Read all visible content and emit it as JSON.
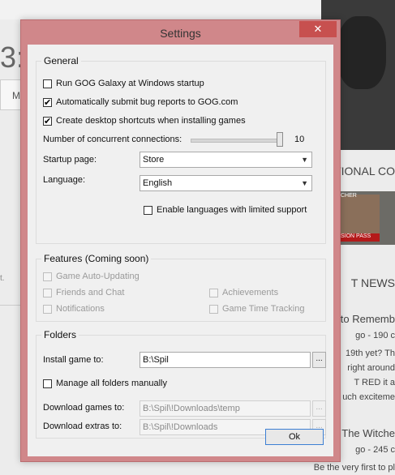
{
  "dialog": {
    "title": "Settings",
    "close_glyph": "✕"
  },
  "general": {
    "title": "General",
    "run_startup": {
      "label": "Run GOG Galaxy at Windows startup",
      "checked": false
    },
    "submit_bugs": {
      "label": "Automatically submit bug reports to GOG.com",
      "checked": true
    },
    "desktop_shortcuts": {
      "label": "Create desktop shortcuts when installing games",
      "checked": true
    },
    "connections_label": "Number of concurrent connections:",
    "connections_value": "10",
    "connections_fraction": 1.0,
    "startup_page_label": "Startup page:",
    "startup_page_value": "Store",
    "language_label": "Language:",
    "language_value": "English",
    "limited_languages": {
      "label": "Enable languages with limited support",
      "checked": false
    }
  },
  "features": {
    "title": "Features (Coming soon)",
    "auto_update": "Game Auto-Updating",
    "friends_chat": "Friends and Chat",
    "notifications": "Notifications",
    "achievements": "Achievements",
    "time_tracking": "Game Time Tracking"
  },
  "folders": {
    "title": "Folders",
    "install_label": "Install game to:",
    "install_value": "B:\\Spil",
    "manage_manually": {
      "label": "Manage all folders manually",
      "checked": false
    },
    "download_games_label": "Download games to:",
    "download_games_value": "B:\\Spil\\!Downloads\\temp",
    "download_extras_label": "Download extras to:",
    "download_extras_value": "B:\\Spil\\!Downloads",
    "browse_label": "..."
  },
  "ok_label": "Ok",
  "background": {
    "big_text": "3:",
    "pill_text": "M",
    "side_text": "t.",
    "right_lines": [
      "TIONAL CO",
      "T NEWS",
      "to Rememb",
      "go - 190 c",
      "19th yet? Th",
      "right around",
      "T RED it a",
      "uch exciteme",
      "The Witche",
      "go - 245 c",
      "Be the very first to pl"
    ],
    "thumb_caption": "SION PASS",
    "thumb_top": "CHER"
  }
}
